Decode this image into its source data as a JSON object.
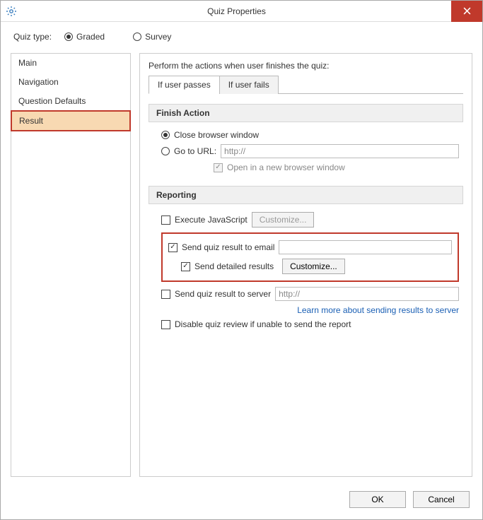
{
  "window": {
    "title": "Quiz Properties"
  },
  "quiztype": {
    "label": "Quiz type:",
    "options": {
      "graded": "Graded",
      "survey": "Survey"
    }
  },
  "sidebar": {
    "items": [
      {
        "label": "Main"
      },
      {
        "label": "Navigation"
      },
      {
        "label": "Question Defaults"
      },
      {
        "label": "Result"
      }
    ]
  },
  "main": {
    "instruction": "Perform the actions when user finishes the quiz:",
    "tabs": {
      "pass": "If user passes",
      "fail": "If user fails"
    },
    "finish": {
      "title": "Finish Action",
      "close": "Close browser window",
      "goto": "Go to URL:",
      "goto_value": "http://",
      "newwin": "Open in a new browser window"
    },
    "reporting": {
      "title": "Reporting",
      "execjs": "Execute JavaScript",
      "customize": "Customize...",
      "sendemail": "Send quiz result to email",
      "email_value": "",
      "senddetail": "Send detailed results",
      "customize2": "Customize...",
      "sendserver": "Send quiz result to server",
      "server_value": "http://",
      "learnmore": "Learn more about sending results to server",
      "disablereview": "Disable quiz review if unable to send the report"
    }
  },
  "footer": {
    "ok": "OK",
    "cancel": "Cancel"
  }
}
